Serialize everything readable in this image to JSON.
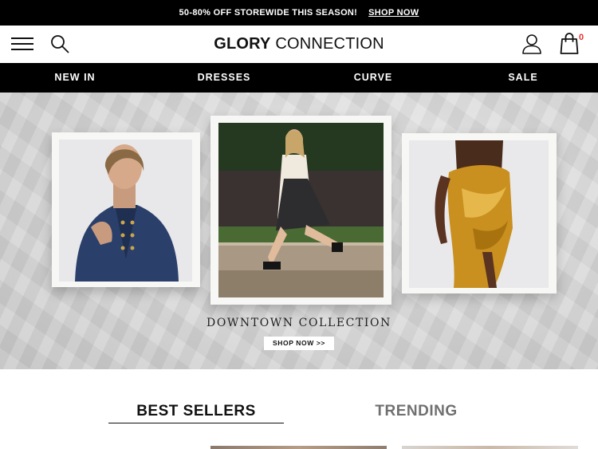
{
  "promo": {
    "text": "50-80% OFF STOREWIDE THIS SEASON!",
    "link_label": "SHOP NOW"
  },
  "header": {
    "logo_bold": "GLORY",
    "logo_light": " CONNECTION",
    "cart_count": "0",
    "icons": [
      "menu-icon",
      "search-icon",
      "user-icon",
      "shopping-bag-icon"
    ]
  },
  "nav": {
    "items": [
      {
        "label": "NEW IN"
      },
      {
        "label": "DRESSES"
      },
      {
        "label": "CURVE"
      },
      {
        "label": "SALE"
      }
    ]
  },
  "hero": {
    "title": "DOWNTOWN COLLECTION",
    "button_label": "SHOP NOW >>"
  },
  "tabs": [
    {
      "label": "BEST SELLERS",
      "active": true
    },
    {
      "label": "TRENDING",
      "active": false
    }
  ],
  "colors": {
    "bar_background": "#000000",
    "cart_badge": "#e8312f",
    "inactive_tab": "#707070"
  }
}
